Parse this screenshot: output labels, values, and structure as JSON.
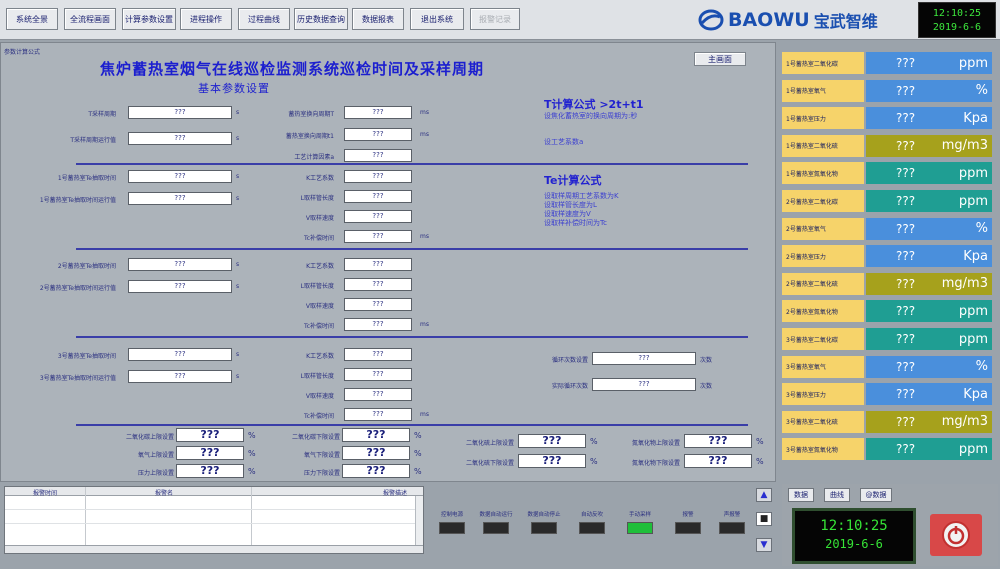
{
  "nav": {
    "buttons": [
      "系统全景",
      "全流程画面",
      "计算参数设置",
      "进程操作",
      "过程曲线",
      "历史数据查询",
      "数据报表",
      "退出系统",
      "报警记录"
    ]
  },
  "brand": {
    "logo": "BAOWU",
    "name": "宝武智维"
  },
  "clock_top": {
    "time": "12:10:25",
    "date": "2019-6-6"
  },
  "page": {
    "corner_label": "参数计算公式",
    "title": "焦炉蓄热室烟气在线巡检监测系统巡检时间及采样周期",
    "subtitle": "基本参数设置",
    "return_button": "主画面"
  },
  "section_t": {
    "left": [
      {
        "label": "T采样周期",
        "value": "???",
        "unit": "s"
      },
      {
        "label": "T采样周期运行值",
        "value": "???",
        "unit": "s"
      }
    ],
    "right": [
      {
        "label": "蓄热室换向周期T",
        "value": "???",
        "unit": "ms"
      },
      {
        "label": "蓄热室换向周期t1",
        "value": "???",
        "unit": "ms"
      },
      {
        "label": "工艺计算因素a",
        "value": "???",
        "unit": ""
      }
    ],
    "formula_title": "T计算公式    >2t+t1",
    "formula_lines": [
      "设焦化蓄热室的换向周期为:秒",
      "",
      "设工艺系数a"
    ]
  },
  "te_formula": {
    "title": "Te计算公式",
    "lines": [
      "设取样周期工艺系数为K",
      "设取样管长度为L",
      "设取样速度为V",
      "设取样补偿时间为Tc"
    ]
  },
  "section1": {
    "left": [
      {
        "label": "1号蓄热室Te抽取时间",
        "value": "???",
        "unit": "s"
      },
      {
        "label": "1号蓄热室Te抽取时间运行值",
        "value": "???",
        "unit": "s"
      }
    ],
    "right": [
      {
        "label": "K工艺系数",
        "value": "???",
        "unit": ""
      },
      {
        "label": "L取样管长度",
        "value": "???",
        "unit": ""
      },
      {
        "label": "V取样速度",
        "value": "???",
        "unit": ""
      },
      {
        "label": "Tc补偿时间",
        "value": "???",
        "unit": "ms"
      }
    ]
  },
  "section2": {
    "left": [
      {
        "label": "2号蓄热室Te抽取时间",
        "value": "???",
        "unit": "s"
      },
      {
        "label": "2号蓄热室Te抽取时间运行值",
        "value": "???",
        "unit": "s"
      }
    ],
    "right": [
      {
        "label": "K工艺系数",
        "value": "???",
        "unit": ""
      },
      {
        "label": "L取样管长度",
        "value": "???",
        "unit": ""
      },
      {
        "label": "V取样速度",
        "value": "???",
        "unit": ""
      },
      {
        "label": "Tc补偿时间",
        "value": "???",
        "unit": "ms"
      }
    ]
  },
  "section3": {
    "left": [
      {
        "label": "3号蓄热室Te抽取时间",
        "value": "???",
        "unit": "s"
      },
      {
        "label": "3号蓄热室Te抽取时间运行值",
        "value": "???",
        "unit": "s"
      }
    ],
    "right": [
      {
        "label": "K工艺系数",
        "value": "???",
        "unit": ""
      },
      {
        "label": "L取样管长度",
        "value": "???",
        "unit": ""
      },
      {
        "label": "V取样速度",
        "value": "???",
        "unit": ""
      },
      {
        "label": "Tc补偿时间",
        "value": "???",
        "unit": "ms"
      }
    ],
    "cycle": [
      {
        "label": "循环次数设置",
        "value": "???",
        "unit": "次数"
      },
      {
        "label": "实际循环次数",
        "value": "???",
        "unit": "次数"
      }
    ]
  },
  "limits": {
    "col1": [
      {
        "label": "二氧化碳上限设置",
        "value": "???",
        "unit": "%"
      },
      {
        "label": "氧气上限设置",
        "value": "???",
        "unit": "%"
      },
      {
        "label": "压力上限设置",
        "value": "???",
        "unit": "%"
      }
    ],
    "col2": [
      {
        "label": "二氧化碳下限设置",
        "value": "???",
        "unit": "%"
      },
      {
        "label": "氧气下限设置",
        "value": "???",
        "unit": "%"
      },
      {
        "label": "压力下限设置",
        "value": "???",
        "unit": "%"
      }
    ],
    "col3": [
      {
        "label": "二氧化硫上限设置",
        "value": "???",
        "unit": "%"
      },
      {
        "label": "二氧化硫下限设置",
        "value": "???",
        "unit": "%"
      }
    ],
    "col4": [
      {
        "label": "氮氧化物上限设置",
        "value": "???",
        "unit": "%"
      },
      {
        "label": "氮氧化物下限设置",
        "value": "???",
        "unit": "%"
      }
    ]
  },
  "sensors": [
    {
      "label": "1号蓄热室二氧化碳",
      "value": "???",
      "unit": "ppm",
      "color": "#4a8fdc"
    },
    {
      "label": "1号蓄热室氧气",
      "value": "???",
      "unit": "%",
      "color": "#4a8fdc"
    },
    {
      "label": "1号蓄热室压力",
      "value": "???",
      "unit": "Kpa",
      "color": "#4a8fdc"
    },
    {
      "label": "1号蓄热室二氧化硫",
      "value": "???",
      "unit": "mg/m3",
      "color": "#a6a11c"
    },
    {
      "label": "1号蓄热室氮氧化物",
      "value": "???",
      "unit": "ppm",
      "color": "#1f9e93"
    },
    {
      "label": "2号蓄热室二氧化碳",
      "value": "???",
      "unit": "ppm",
      "color": "#1f9e93"
    },
    {
      "label": "2号蓄热室氧气",
      "value": "???",
      "unit": "%",
      "color": "#4a8fdc"
    },
    {
      "label": "2号蓄热室压力",
      "value": "???",
      "unit": "Kpa",
      "color": "#4a8fdc"
    },
    {
      "label": "2号蓄热室二氧化硫",
      "value": "???",
      "unit": "mg/m3",
      "color": "#a6a11c"
    },
    {
      "label": "2号蓄热室氮氧化物",
      "value": "???",
      "unit": "ppm",
      "color": "#1f9e93"
    },
    {
      "label": "3号蓄热室二氧化碳",
      "value": "???",
      "unit": "ppm",
      "color": "#1f9e93"
    },
    {
      "label": "3号蓄热室氧气",
      "value": "???",
      "unit": "%",
      "color": "#4a8fdc"
    },
    {
      "label": "3号蓄热室压力",
      "value": "???",
      "unit": "Kpa",
      "color": "#4a8fdc"
    },
    {
      "label": "3号蓄热室二氧化硫",
      "value": "???",
      "unit": "mg/m3",
      "color": "#a6a11c"
    },
    {
      "label": "3号蓄热室氮氧化物",
      "value": "???",
      "unit": "ppm",
      "color": "#1f9e93"
    }
  ],
  "alarm_table": {
    "headers": [
      "报警时间",
      "报警名",
      "报警描述"
    ]
  },
  "lamps": [
    {
      "label": "控制电源",
      "color": "#2a2a2a"
    },
    {
      "label": "数据自动运行",
      "color": "#2a2a2a"
    },
    {
      "label": "数据自动停止",
      "color": "#2a2a2a"
    },
    {
      "label": "自动反吹",
      "color": "#2a2a2a"
    },
    {
      "label": "手动采样",
      "color": "#1fbf3a"
    },
    {
      "label": "报警",
      "color": "#2a2a2a"
    },
    {
      "label": "声报警",
      "color": "#2a2a2a"
    }
  ],
  "bottom_buttons": [
    "数据",
    "曲线",
    "@数据"
  ],
  "clock_bottom": {
    "time": "12:10:25",
    "date": "2019-6-6"
  }
}
